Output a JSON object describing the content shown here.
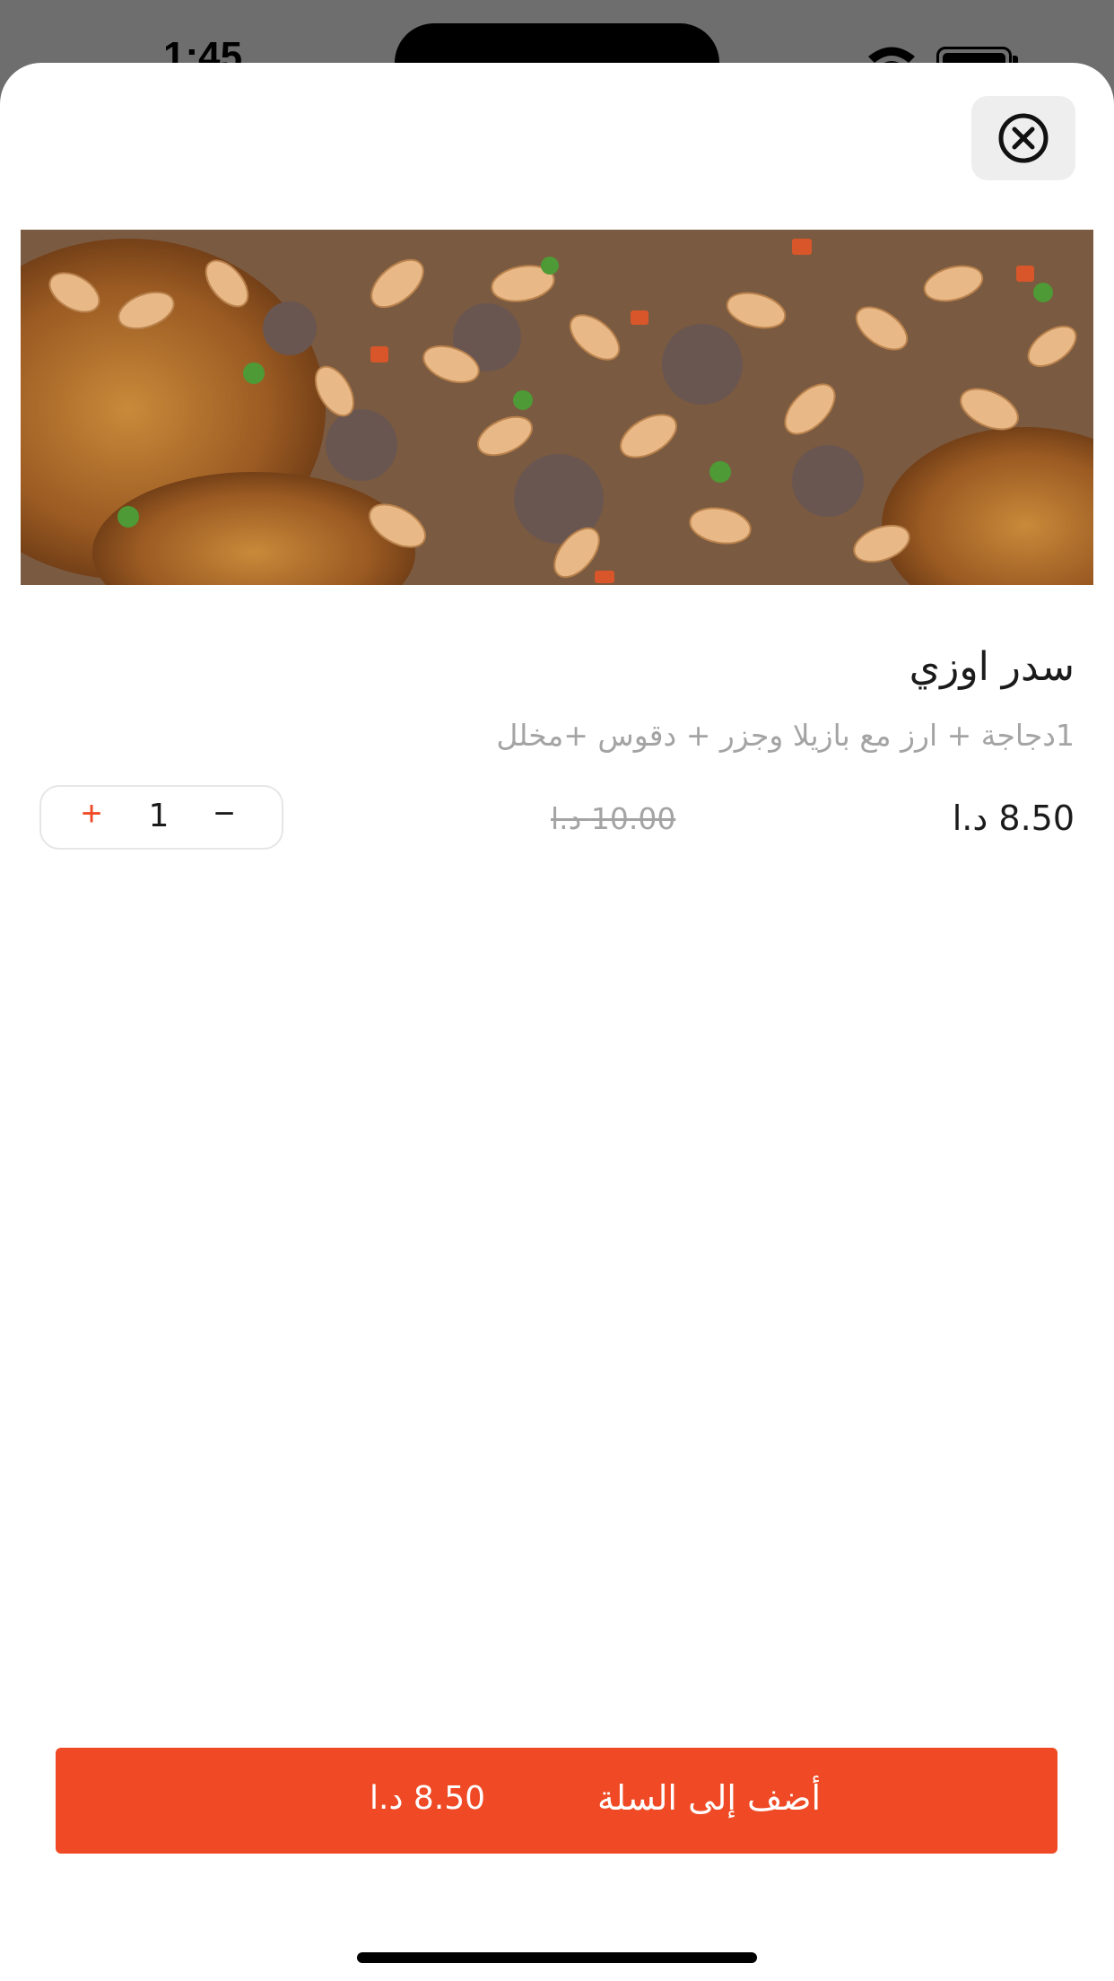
{
  "status_bar": {
    "time": "1:45"
  },
  "close_button": {
    "icon": "close-circle-icon"
  },
  "dish": {
    "image": "food-photo",
    "title": "سدر اوزي",
    "description": "1دجاجة + ارز مع بازيلا وجزر + دقوس +مخلل",
    "price": "8.50 د.ا",
    "old_price": "10.00 د.ا"
  },
  "quantity": {
    "plus_label": "+",
    "value": "1",
    "minus_label": "−"
  },
  "add_to_cart": {
    "label": "أضف إلى السلة",
    "price": "8.50 د.ا"
  },
  "colors": {
    "accent": "#ef4a25",
    "text_primary": "#1b1b1b",
    "text_muted": "#a4a4a4"
  }
}
